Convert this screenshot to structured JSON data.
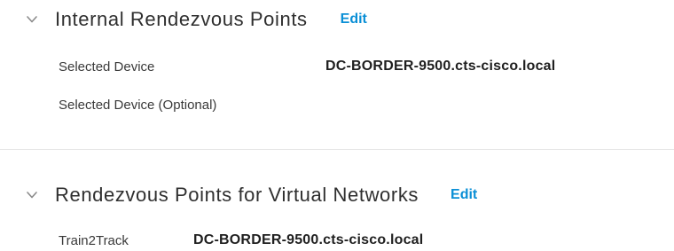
{
  "internal_rp": {
    "title": "Internal Rendezvous Points",
    "edit_label": "Edit",
    "rows": [
      {
        "label": "Selected Device",
        "value": "DC-BORDER-9500.cts-cisco.local"
      },
      {
        "label": "Selected Device (Optional)",
        "value": ""
      }
    ]
  },
  "virtual_rp": {
    "title": "Rendezvous Points for Virtual Networks",
    "edit_label": "Edit",
    "rows": [
      {
        "label": "Train2Track",
        "value": "DC-BORDER-9500.cts-cisco.local"
      }
    ]
  },
  "icons": {
    "collapse": "chevron-down-icon"
  },
  "colors": {
    "accent": "#0a8fd6",
    "text": "#2f2f2f",
    "divider": "#e6e6e6"
  }
}
